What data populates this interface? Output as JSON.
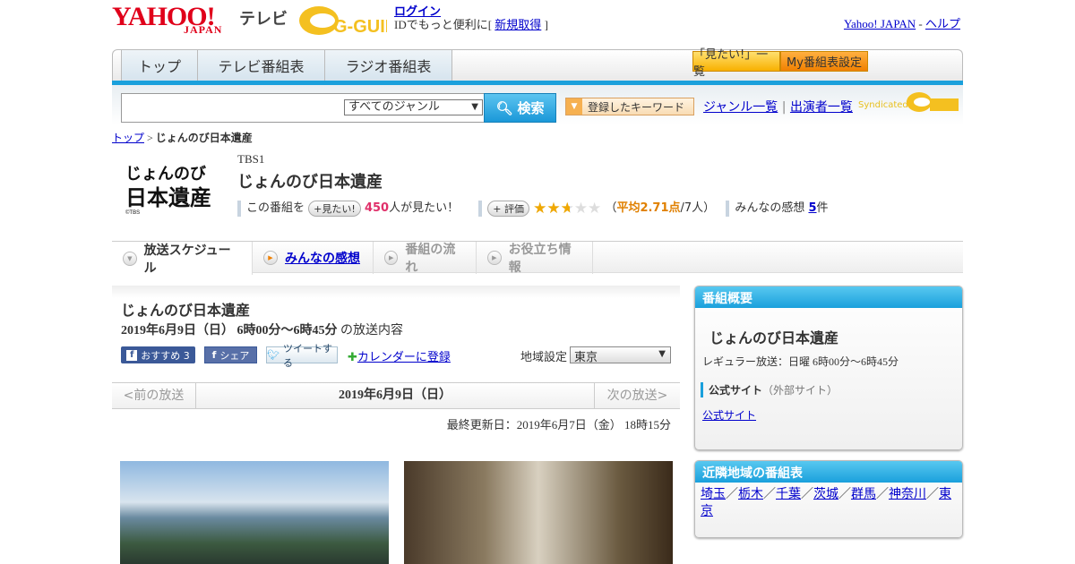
{
  "header": {
    "logo_text": "YAHOO!",
    "logo_sub": "JAPAN",
    "service": "テレビ",
    "gguide_logo": "G-GUIDE",
    "login": "ログイン",
    "id_text_pre": "IDでもっと便利に[ ",
    "signup": "新規取得",
    "id_text_post": " ]",
    "yahoo_japan": "Yahoo! JAPAN",
    "sep": " - ",
    "help": "ヘルプ"
  },
  "nav": {
    "tabs": [
      "トップ",
      "テレビ番組表",
      "ラジオ番組表"
    ],
    "mitai_list": "「見たい!」一覧",
    "my_settings": "My番組表設定"
  },
  "search": {
    "value": "",
    "genre": "すべてのジャンル",
    "button": "検索",
    "keyword": "登録したキーワード",
    "genre_list": "ジャンル一覧",
    "cast_list": "出演者一覧",
    "pipe": "|",
    "syndicated": "Syndicated"
  },
  "breadcrumb": {
    "top": "トップ",
    "sep": " > ",
    "current": "じょんのび日本遺産"
  },
  "program": {
    "logo_line1": "じょんのび",
    "logo_line2": "日本遺産",
    "copyright": "©TBS",
    "channel": "TBS1",
    "title": "じょんのび日本遺産",
    "this_program": "この番組を",
    "mitai_btn": "+見たい!",
    "mitai_count": "450",
    "mitai_suffix": "人が見たい！",
    "rate_btn": "+ 評価",
    "rating": 2.71,
    "rating_open": "（",
    "rating_avg": "平均2.71点",
    "rating_count": "/7人）",
    "impressions_label": "みんなの感想",
    "impressions_count": "5",
    "impressions_suffix": "件"
  },
  "subtabs": [
    "放送スケジュール",
    "みんなの感想",
    "番組の流れ",
    "お役立ち情報"
  ],
  "broadcast": {
    "title": "じょんのび日本遺産",
    "datetime": "2019年6月9日（日） 6時00分～6時45分",
    "suffix": "の放送内容",
    "fb_recommend": "おすすめ 3",
    "fb_share": "シェア",
    "tweet": "ツイートする",
    "calendar": "カレンダーに登録",
    "region_label": "地域設定",
    "region": "東京",
    "prev": "<前の放送",
    "date": "2019年6月9日（日）",
    "next": "次の放送>",
    "updated": "最終更新日：2019年6月7日（金） 18時15分"
  },
  "summary": {
    "header": "番組概要",
    "title": "じょんのび日本遺産",
    "regular": "レギュラー放送：日曜 6時00分～6時45分",
    "official_label": "公式サイト",
    "official_note": "（外部サイト）",
    "official_link": "公式サイト"
  },
  "nearby": {
    "header": "近隣地域の番組表",
    "regions": [
      "埼玉",
      "栃木",
      "千葉",
      "茨城",
      "群馬",
      "神奈川",
      "東京"
    ],
    "sep": "／"
  },
  "colors": {
    "accent": "#1aa0dc",
    "link": "#0000cc",
    "mitai_count": "#e0306a",
    "rating": "#e08000"
  }
}
